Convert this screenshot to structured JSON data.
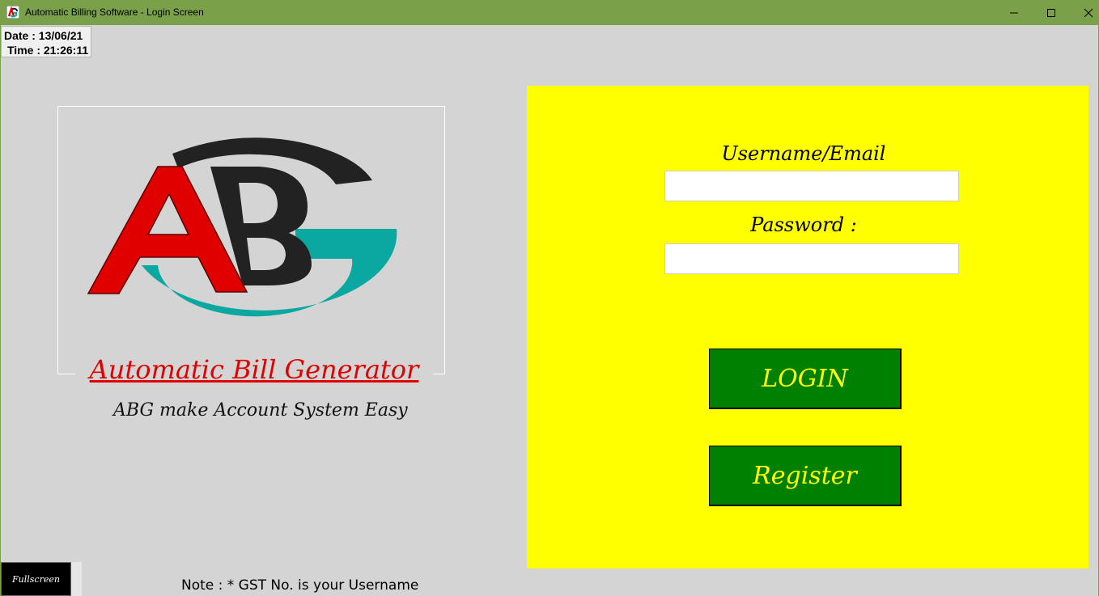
{
  "window": {
    "title": "Automatic Billing Software - Login Screen",
    "app_icon": "abg-logo-icon",
    "titlebar_color": "#7aa04a",
    "controls": [
      "minimize-icon",
      "maximize-icon",
      "close-icon"
    ]
  },
  "clock": {
    "date": "Date : 13/06/21",
    "time": "Time : 21:26:11"
  },
  "branding": {
    "logo_letters": "ABG",
    "title": "Automatic Bill Generator",
    "tagline": "ABG make Account System Easy",
    "colors": {
      "red": "#e00000",
      "black": "#222222",
      "teal": "#0aa8a0"
    }
  },
  "login_form": {
    "panel_color": "#ffff00",
    "username_label": "Username/Email",
    "username_value": "",
    "password_label": "Password :",
    "password_value": "",
    "login_button": "LOGIN",
    "register_button": "Register",
    "button_color": "#008000",
    "button_text_color": "#ffff00"
  },
  "footer": {
    "fullscreen_button": "Fullscreen",
    "note": "Note : * GST No. is your Username"
  }
}
